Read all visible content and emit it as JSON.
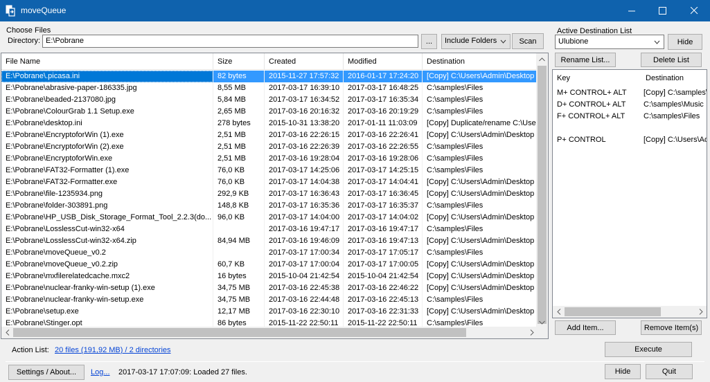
{
  "window": {
    "title": "moveQueue"
  },
  "choose_files": {
    "group_label": "Choose Files",
    "directory_label": "Directory:",
    "directory_value": "E:\\Pobrane",
    "browse_label": "...",
    "include_option": "Include Folders",
    "scan_label": "Scan"
  },
  "table": {
    "headers": [
      "File Name",
      "Size",
      "Created",
      "Modified",
      "Destination"
    ],
    "rows": [
      [
        "E:\\Pobrane\\.picasa.ini",
        "82 bytes",
        "2015-11-27  17:57:32",
        "2016-01-17  17:24:20",
        "[Copy] C:\\Users\\Admin\\Desktop"
      ],
      [
        "E:\\Pobrane\\abrasive-paper-186335.jpg",
        "8,55 MB",
        "2017-03-17  16:39:10",
        "2017-03-17  16:48:25",
        "C:\\samples\\Files"
      ],
      [
        "E:\\Pobrane\\beaded-2137080.jpg",
        "5,84 MB",
        "2017-03-17  16:34:52",
        "2017-03-17  16:35:34",
        "C:\\samples\\Files"
      ],
      [
        "E:\\Pobrane\\ColourGrab 1.1 Setup.exe",
        "2,65 MB",
        "2017-03-16  20:16:32",
        "2017-03-16  20:19:29",
        "C:\\samples\\Files"
      ],
      [
        "E:\\Pobrane\\desktop.ini",
        "278 bytes",
        "2015-10-31  13:38:20",
        "2017-01-11  11:03:09",
        "[Copy] Duplicate/rename C:\\Users"
      ],
      [
        "E:\\Pobrane\\EncryptoforWin (1).exe",
        "2,51 MB",
        "2017-03-16  22:26:15",
        "2017-03-16  22:26:41",
        "[Copy] C:\\Users\\Admin\\Desktop"
      ],
      [
        "E:\\Pobrane\\EncryptoforWin (2).exe",
        "2,51 MB",
        "2017-03-16  22:26:39",
        "2017-03-16  22:26:55",
        "C:\\samples\\Files"
      ],
      [
        "E:\\Pobrane\\EncryptoforWin.exe",
        "2,51 MB",
        "2017-03-16  19:28:04",
        "2017-03-16  19:28:06",
        "C:\\samples\\Files"
      ],
      [
        "E:\\Pobrane\\FAT32-Formatter (1).exe",
        "76,0 KB",
        "2017-03-17  14:25:06",
        "2017-03-17  14:25:15",
        "C:\\samples\\Files"
      ],
      [
        "E:\\Pobrane\\FAT32-Formatter.exe",
        "76,0 KB",
        "2017-03-17  14:04:38",
        "2017-03-17  14:04:41",
        "[Copy] C:\\Users\\Admin\\Desktop"
      ],
      [
        "E:\\Pobrane\\file-1235934.png",
        "292,9 KB",
        "2017-03-17  16:36:43",
        "2017-03-17  16:36:45",
        "[Copy] C:\\Users\\Admin\\Desktop"
      ],
      [
        "E:\\Pobrane\\folder-303891.png",
        "148,8 KB",
        "2017-03-17  16:35:36",
        "2017-03-17  16:35:37",
        "C:\\samples\\Files"
      ],
      [
        "E:\\Pobrane\\HP_USB_Disk_Storage_Format_Tool_2.2.3(do...",
        "96,0 KB",
        "2017-03-17  14:04:00",
        "2017-03-17  14:04:02",
        "[Copy] C:\\Users\\Admin\\Desktop"
      ],
      [
        "E:\\Pobrane\\LosslessCut-win32-x64",
        "",
        "2017-03-16  19:47:17",
        "2017-03-16  19:47:17",
        "C:\\samples\\Files"
      ],
      [
        "E:\\Pobrane\\LosslessCut-win32-x64.zip",
        "84,94 MB",
        "2017-03-16  19:46:09",
        "2017-03-16  19:47:13",
        "[Copy] C:\\Users\\Admin\\Desktop"
      ],
      [
        "E:\\Pobrane\\moveQueue_v0.2",
        "",
        "2017-03-17  17:00:34",
        "2017-03-17  17:05:17",
        "C:\\samples\\Files"
      ],
      [
        "E:\\Pobrane\\moveQueue_v0.2.zip",
        "60,7 KB",
        "2017-03-17  17:00:04",
        "2017-03-17  17:00:05",
        "[Copy] C:\\Users\\Admin\\Desktop"
      ],
      [
        "E:\\Pobrane\\mxfilerelatedcache.mxc2",
        "16 bytes",
        "2015-10-04  21:42:54",
        "2015-10-04  21:42:54",
        "[Copy] C:\\Users\\Admin\\Desktop"
      ],
      [
        "E:\\Pobrane\\nuclear-franky-win-setup (1).exe",
        "34,75 MB",
        "2017-03-16  22:45:38",
        "2017-03-16  22:46:22",
        "[Copy] C:\\Users\\Admin\\Desktop"
      ],
      [
        "E:\\Pobrane\\nuclear-franky-win-setup.exe",
        "34,75 MB",
        "2017-03-16  22:44:48",
        "2017-03-16  22:45:13",
        "C:\\samples\\Files"
      ],
      [
        "E:\\Pobrane\\setup.exe",
        "12,17 MB",
        "2017-03-16  22:30:10",
        "2017-03-16  22:31:33",
        "[Copy] C:\\Users\\Admin\\Desktop"
      ],
      [
        "E:\\Pobrane\\Stinger.opt",
        "86 bytes",
        "2015-11-22  22:50:11",
        "2015-11-22  22:50:11",
        "C:\\samples\\Files"
      ]
    ]
  },
  "destination": {
    "group_label": "Active Destination List",
    "selected_list": "Ulubione",
    "hide_label": "Hide",
    "rename_label": "Rename List...",
    "delete_label": "Delete List",
    "headers": [
      "Key",
      "Destination"
    ],
    "rows": [
      [
        "M+ CONTROL+ ALT",
        "[Copy] C:\\samples\\"
      ],
      [
        "D+ CONTROL+ ALT",
        "C:\\samples\\Music"
      ],
      [
        "F+ CONTROL+ ALT",
        "C:\\samples\\Files"
      ],
      [
        "",
        ""
      ],
      [
        "P+ CONTROL",
        "[Copy] C:\\Users\\Ad"
      ]
    ],
    "add_label": "Add Item...",
    "remove_label": "Remove Item(s)"
  },
  "footer": {
    "action_label": "Action List:",
    "action_link": "20 files (191,92 MB) / 2 directories",
    "execute_label": "Execute",
    "settings_label": "Settings / About...",
    "log_label": "Log...",
    "status_text": "2017-03-17 17:07:09: Loaded 27 files.",
    "hide_label": "Hide",
    "quit_label": "Quit"
  },
  "colors": {
    "titlebar": "#0f62ad",
    "selection": "#3399ff",
    "link": "#0645d6"
  }
}
